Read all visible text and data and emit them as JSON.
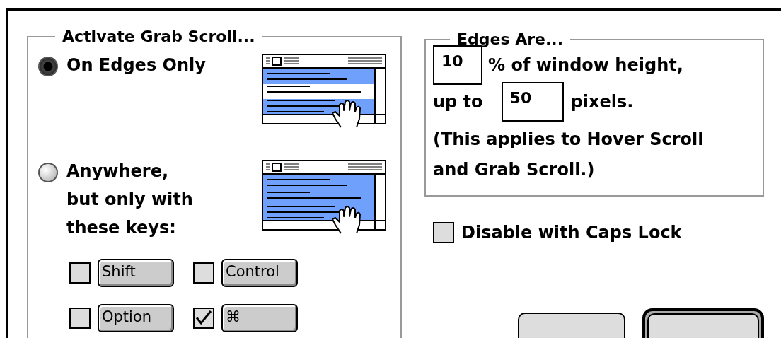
{
  "activate_group": {
    "title": "Activate Grab Scroll...",
    "options": [
      {
        "label": "On Edges Only",
        "selected": true,
        "kind": "edges"
      },
      {
        "label": "Anywhere, but only with these keys:",
        "selected": false,
        "kind": "anywhere"
      }
    ],
    "keys": [
      {
        "label": "Shift",
        "checked": false
      },
      {
        "label": "Control",
        "checked": false
      },
      {
        "label": "Option",
        "checked": false
      },
      {
        "label": "⌘",
        "checked": true
      }
    ]
  },
  "edges_group": {
    "title": "Edges Are...",
    "percent": "10",
    "percent_label": "% of window height,",
    "up_to_label": "up to",
    "pixels": "50",
    "pixels_label": "pixels.",
    "note": "(This applies to Hover Scroll and Grab Scroll.)"
  },
  "caps_lock": {
    "label": "Disable with Caps Lock",
    "checked": false
  },
  "buttons": [
    {
      "default": false
    },
    {
      "default": true
    }
  ]
}
